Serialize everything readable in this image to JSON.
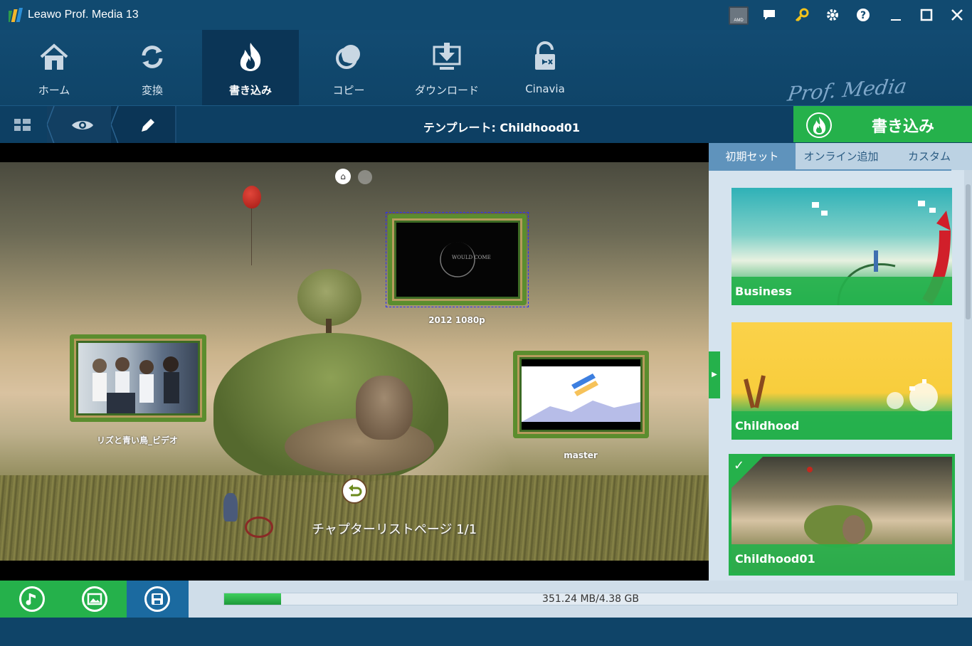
{
  "window": {
    "title": "Leawo Prof. Media 13",
    "chip_label": "AMD"
  },
  "titlebar_icons": [
    "amd-chip-icon",
    "message-icon",
    "key-icon",
    "gear-icon",
    "help-icon",
    "minimize-icon",
    "maximize-icon",
    "close-icon"
  ],
  "nav": {
    "items": [
      {
        "label": "ホーム",
        "icon": "home-icon"
      },
      {
        "label": "変換",
        "icon": "convert-icon"
      },
      {
        "label": "書き込み",
        "icon": "burn-icon",
        "active": true
      },
      {
        "label": "コピー",
        "icon": "disc-copy-icon"
      },
      {
        "label": "ダウンロード",
        "icon": "download-icon"
      },
      {
        "label": "Cinavia",
        "icon": "cinavia-icon"
      }
    ],
    "brand": "Prof. Media"
  },
  "subbar": {
    "template_label": "テンプレート: Childhood01",
    "burn_button": "書き込み"
  },
  "preview": {
    "thumbnails": [
      {
        "label": "2012 1080p",
        "inner_text": "WOULD COME"
      },
      {
        "label": "リズと青い鳥_ビデオ"
      },
      {
        "label": "master"
      }
    ],
    "chapter_text": "チャプターリストページ 1/1"
  },
  "panel": {
    "tabs": [
      "初期セット",
      "オンライン追加",
      "カスタム"
    ],
    "templates": [
      {
        "name": "Business"
      },
      {
        "name": "Childhood"
      },
      {
        "name": "Childhood01",
        "selected": true
      }
    ]
  },
  "status": {
    "usage_text": "351.24 MB/4.38 GB",
    "usage_fraction": 0.078
  },
  "colors": {
    "accent_green": "#25b14b",
    "nav_blue": "#0f4468",
    "selection_border": "#2c2cff"
  }
}
